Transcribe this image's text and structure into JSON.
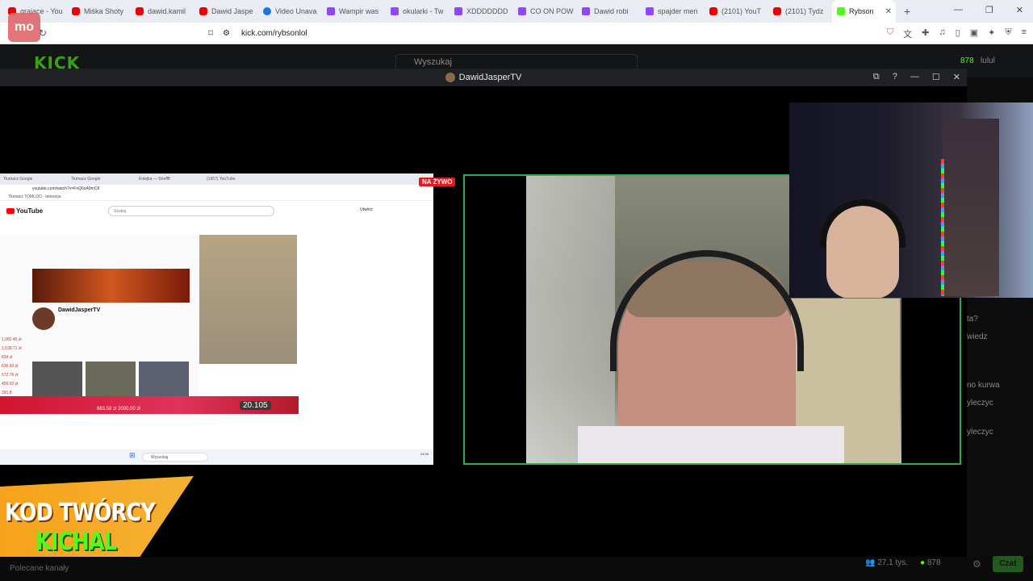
{
  "browser": {
    "tabs": [
      {
        "label": "grające - You",
        "icon": "youtube"
      },
      {
        "label": "Miśka Shoty",
        "icon": "youtube"
      },
      {
        "label": "dawid.kamil",
        "icon": "youtube"
      },
      {
        "label": "Dawid Jaspe",
        "icon": "youtube"
      },
      {
        "label": "Video Unava",
        "icon": "blue"
      },
      {
        "label": "Wampir was",
        "icon": "twitch"
      },
      {
        "label": "okularki - Tw",
        "icon": "twitch"
      },
      {
        "label": "XDDDDDDD",
        "icon": "twitch"
      },
      {
        "label": "CO ON POW",
        "icon": "twitch"
      },
      {
        "label": "Dawid robi",
        "icon": "twitch"
      },
      {
        "label": "spajder men",
        "icon": "twitch"
      },
      {
        "label": "(2101) YouT",
        "icon": "youtube"
      },
      {
        "label": "(2101) Tydz",
        "icon": "youtube"
      },
      {
        "label": "Rybson",
        "icon": "kick",
        "active": true
      }
    ],
    "url": "kick.com/rybsonlol",
    "logo_badge": "mo"
  },
  "kick": {
    "logo": "KICK",
    "search_placeholder": "Wyszukaj",
    "header_viewers": "878",
    "header_user": "lulul"
  },
  "popup": {
    "title": "DawidJasperTV",
    "live_badge": "NA ŻYWO"
  },
  "inner": {
    "tabs": [
      "Tłumacz Google",
      "Tłumacz Google",
      "Kolejka — Streffff",
      "(1957) YouTube"
    ],
    "url": "youtube.com/watch?v=FnQ6oA9mC8",
    "bookmarks": "Tłumacz     TOMLOO - telewizja",
    "yt_logo": "YouTube",
    "yt_search": "Szukaj",
    "yt_create": "Utwórz",
    "channel_name": "DawidJasperTV",
    "amounts": [
      "1,982.45 zł",
      "1,539.71 zł",
      "834 zł",
      "636.60 zł",
      "572.76 zł",
      "459.92 zł",
      "391.8"
    ],
    "donation": "20.105",
    "strip_text": "883.58 zł      2000.00 zł",
    "taskbar_search": "Wyszukaj",
    "taskbar_clock": "23:45"
  },
  "chat": {
    "lines": [
      "ta?",
      "wiedz",
      "no kurwa",
      "yleczyc",
      "yleczyc"
    ]
  },
  "promo": {
    "line1": "KOD TWÓRCY",
    "line2": "KICHAL"
  },
  "bottom": {
    "recommended": "Polecane kanały",
    "viewers": "27,1 tys.",
    "count": "878",
    "chat_button": "Czat"
  }
}
